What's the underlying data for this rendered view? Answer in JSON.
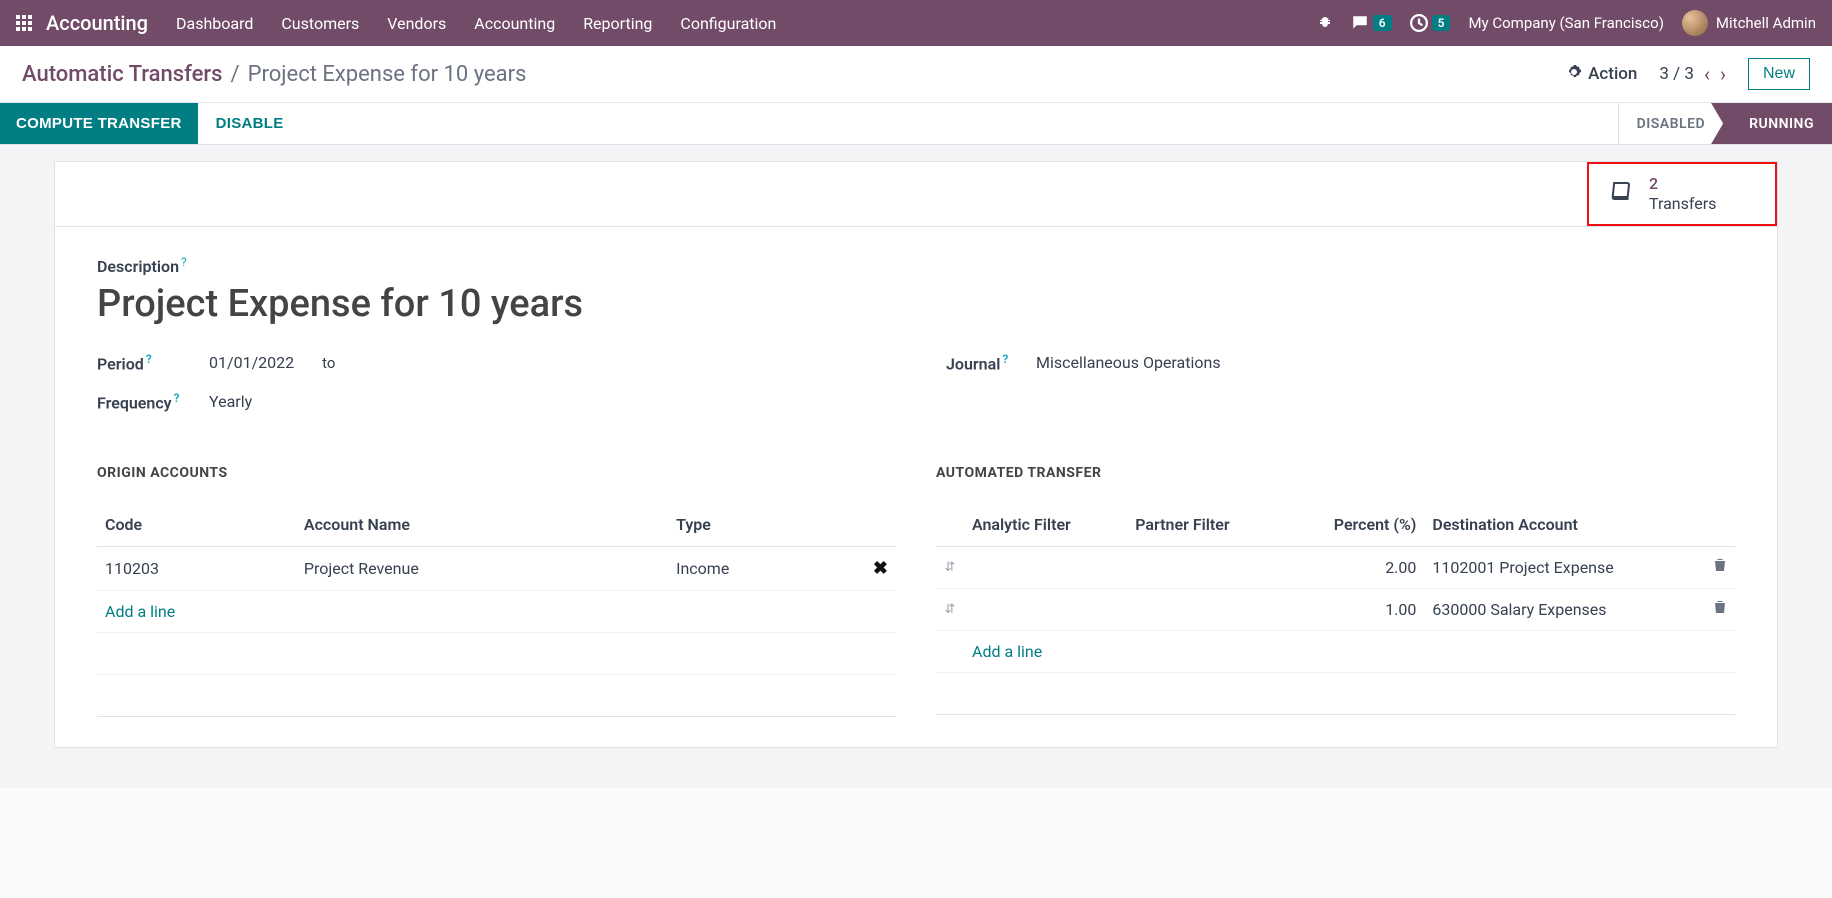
{
  "nav": {
    "app": "Accounting",
    "links": [
      "Dashboard",
      "Customers",
      "Vendors",
      "Accounting",
      "Reporting",
      "Configuration"
    ],
    "chat_badge": "6",
    "clock_badge": "5",
    "company": "My Company (San Francisco)",
    "user": "Mitchell Admin"
  },
  "breadcrumb": {
    "parent": "Automatic Transfers",
    "current": "Project Expense for 10 years",
    "action_label": "Action",
    "pager": "3 / 3",
    "new_label": "New"
  },
  "actions": {
    "compute": "COMPUTE TRANSFER",
    "disable": "DISABLE",
    "status_disabled": "DISABLED",
    "status_running": "RUNNING"
  },
  "statbox": {
    "count": "2",
    "label": "Transfers"
  },
  "form": {
    "desc_label": "Description",
    "title": "Project Expense for 10 years",
    "period_label": "Period",
    "period_from": "01/01/2022",
    "period_to_word": "to",
    "freq_label": "Frequency",
    "freq_val": "Yearly",
    "journal_label": "Journal",
    "journal_val": "Miscellaneous Operations"
  },
  "origin": {
    "heading": "ORIGIN ACCOUNTS",
    "cols": {
      "code": "Code",
      "name": "Account Name",
      "type": "Type"
    },
    "rows": [
      {
        "code": "110203",
        "name": "Project Revenue",
        "type": "Income"
      }
    ],
    "add": "Add a line"
  },
  "auto": {
    "heading": "AUTOMATED TRANSFER",
    "cols": {
      "analytic": "Analytic Filter",
      "partner": "Partner Filter",
      "percent": "Percent (%)",
      "dest": "Destination Account"
    },
    "rows": [
      {
        "analytic": "",
        "partner": "",
        "percent": "2.00",
        "dest": "1102001 Project Expense"
      },
      {
        "analytic": "",
        "partner": "",
        "percent": "1.00",
        "dest": "630000 Salary Expenses"
      }
    ],
    "add": "Add a line"
  }
}
